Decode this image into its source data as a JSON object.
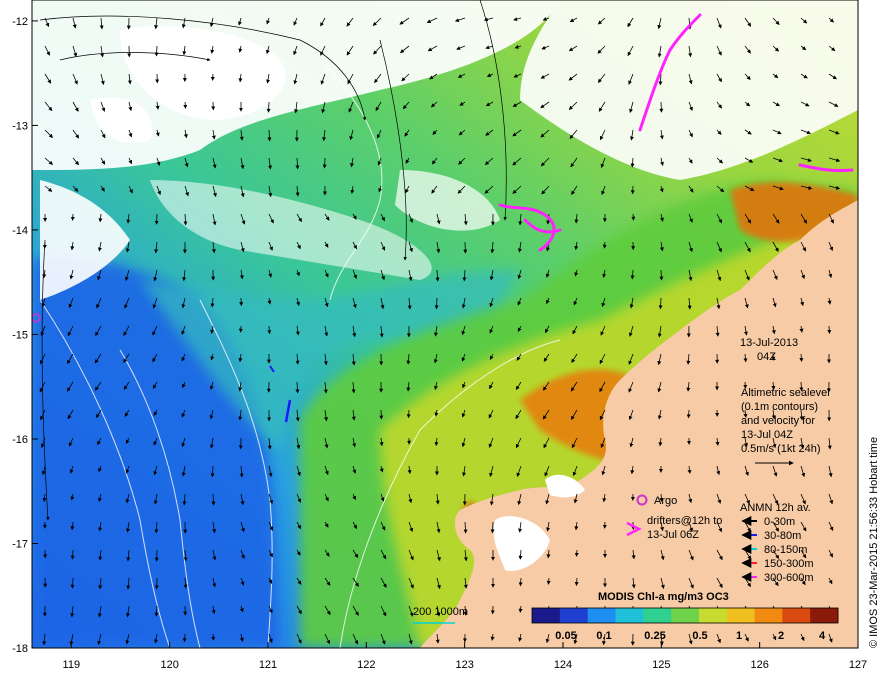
{
  "map": {
    "lon_range": [
      118.6,
      127.0
    ],
    "lat_range": [
      -18.0,
      -11.8
    ],
    "lon_ticks": [
      "119",
      "120",
      "121",
      "122",
      "123",
      "124",
      "125",
      "126",
      "127"
    ],
    "lat_ticks": [
      "-12",
      "-13",
      "-14",
      "-15",
      "-16",
      "-17",
      "-18"
    ],
    "colors": {
      "land": "#f6cba5",
      "cloud": "#ffffff",
      "ocean_low": "#1f6fe8",
      "ocean_mid": "#39c69a",
      "ocean_high": "#b9d93a",
      "coast_high": "#e07a10"
    }
  },
  "info": {
    "date": "13-Jul-2013",
    "time": "04Z",
    "altimetry_lines": [
      "Altimetric sealevel",
      "(0.1m contours)",
      "and velocity for",
      "13-Jul 04Z",
      "0.5m/s (1kt 24h)"
    ]
  },
  "legend": {
    "argo_label": "Argo",
    "drifters_line1": "drifters@12h to",
    "drifters_line2": "13-Jul 06Z",
    "anmn_title": "ANMN 12h av.",
    "depths": [
      {
        "label": "0-30m",
        "color": "#000000"
      },
      {
        "label": "30-80m",
        "color": "#1a1aff"
      },
      {
        "label": "80-150m",
        "color": "#00d4d4"
      },
      {
        "label": "150-300m",
        "color": "#ff2020"
      },
      {
        "label": "300-600m",
        "color": "#ff22ff"
      }
    ]
  },
  "colorbar": {
    "title": "MODIS Chl-a mg/m3 OC3",
    "tick_labels": [
      "0.05",
      "0.1",
      "0.25",
      "0.5",
      "1",
      "2",
      "4"
    ],
    "colors": [
      "#1a1a8a",
      "#1e3fd0",
      "#1e8ef0",
      "#20c0d8",
      "#30d090",
      "#6ed24a",
      "#c6dc30",
      "#f0c020",
      "#f08a10",
      "#d84a10",
      "#8a1a0a"
    ]
  },
  "scale": {
    "label": "200 1000m"
  },
  "credit": "© IMOS 23-Mar-2015 21:56:33 Hobart time"
}
